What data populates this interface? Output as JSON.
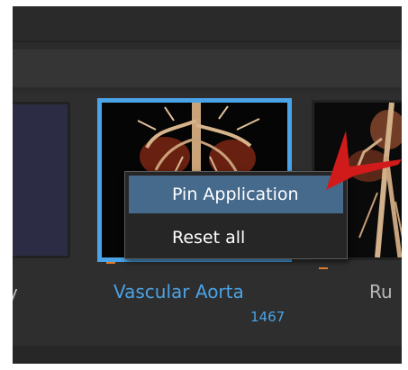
{
  "colors": {
    "background": "#2e2e2e",
    "accent": "#4aa3e6",
    "menu_highlight": "#466a8c",
    "marker": "#e07a2c",
    "arrow": "#d11a1a"
  },
  "gallery": {
    "items": [
      {
        "label": "y",
        "selected": false
      },
      {
        "label": "Vascular Aorta",
        "count": "1467",
        "selected": true
      },
      {
        "label": "Ru",
        "selected": false
      }
    ]
  },
  "context_menu": {
    "items": [
      {
        "label": "Pin Application",
        "highlighted": true
      },
      {
        "label": "Reset all",
        "highlighted": false
      }
    ]
  },
  "annotation": {
    "icon": "red-arrow-pointer"
  }
}
